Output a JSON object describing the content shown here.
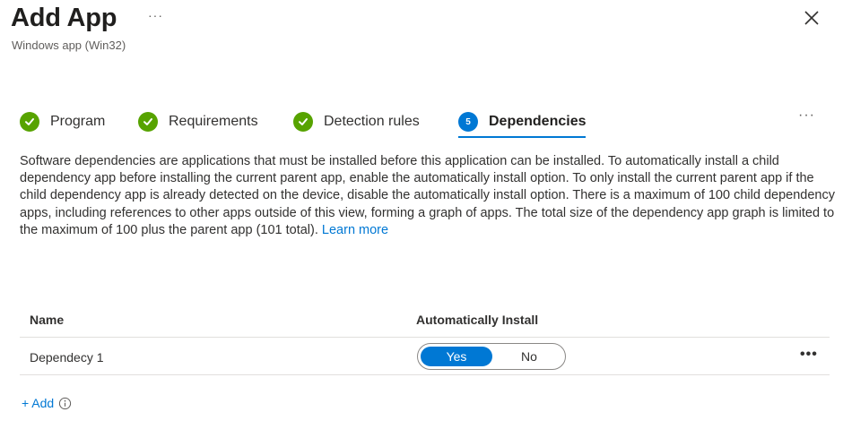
{
  "header": {
    "title": "Add App",
    "more": "···",
    "subtitle": "Windows app (Win32)"
  },
  "tabs": [
    {
      "label": "Program",
      "state": "complete"
    },
    {
      "label": "Requirements",
      "state": "complete"
    },
    {
      "label": "Detection rules",
      "state": "complete"
    },
    {
      "label": "Dependencies",
      "state": "active",
      "step": "5"
    }
  ],
  "tabs_more": "···",
  "description": {
    "text": "Software dependencies are applications that must be installed before this application can be installed. To automatically install a child dependency app before installing the current parent app, enable the automatically install option. To only install the current parent app if the child dependency app is already detected on the device, disable the automatically install option. There is a maximum of 100 child dependency apps, including references to other apps outside of this view, forming a graph of apps. The total size of the dependency app graph is limited to the maximum of 100 plus the parent app (101 total). ",
    "link": "Learn more"
  },
  "table": {
    "columns": [
      "Name",
      "Automatically Install"
    ],
    "rows": [
      {
        "name": "Dependecy 1",
        "toggle_yes": "Yes",
        "toggle_no": "No",
        "selected": "Yes",
        "more": "•••"
      }
    ]
  },
  "add_label": "+ Add",
  "colors": {
    "accent": "#0078d4",
    "success": "#57a300"
  }
}
